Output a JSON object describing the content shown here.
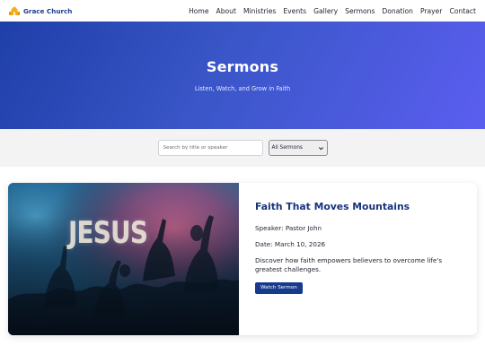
{
  "navbar": {
    "brand_name": "Grace Church",
    "logo_icon": "church-icon",
    "links": [
      "Home",
      "About",
      "Ministries",
      "Events",
      "Gallery",
      "Sermons",
      "Donation",
      "Prayer",
      "Contact"
    ]
  },
  "hero": {
    "title": "Sermons",
    "subtitle": "Listen, Watch, and Grow in Faith"
  },
  "filter": {
    "search_placeholder": "Search by title or speaker",
    "search_value": "",
    "select_value": "All Sermons"
  },
  "sermon": {
    "image_word": "JESUS",
    "title": "Faith That Moves Mountains",
    "speaker": "Speaker: Pastor John",
    "date": "Date: March 10, 2026",
    "description": "Discover how faith empowers believers to overcome life's greatest challenges.",
    "button_label": "Watch Sermon"
  },
  "colors": {
    "brand": "#1b3c8f",
    "hero_gradient_start": "#1f3fa8",
    "hero_gradient_end": "#5b5ef0",
    "button": "#163a8c"
  }
}
